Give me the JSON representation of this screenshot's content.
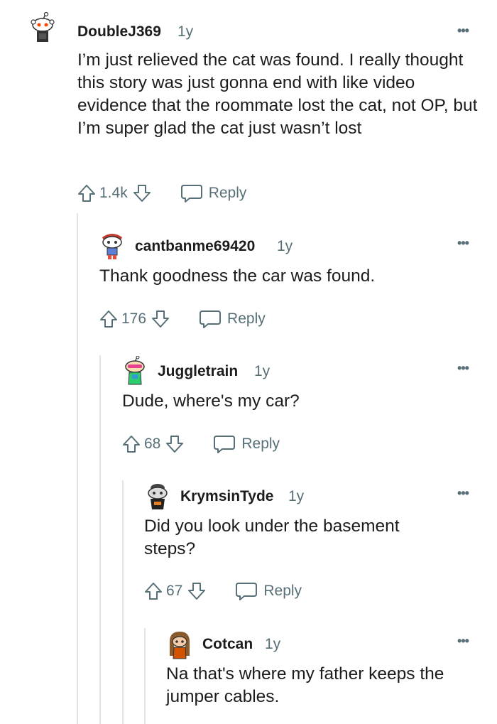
{
  "comments": [
    {
      "username": "DoubleJ369",
      "age": "1y",
      "body": "I’m just relieved the cat was found. I really thought this story was just gonna end with like video evidence that the roommate lost the cat, not OP, but I’m super glad the cat just wasn’t lost",
      "votes": "1.4k",
      "reply_label": "Reply",
      "more_label": "•••",
      "avatar": "snoo-avatar-antenna-red"
    },
    {
      "username": "cantbanme69420",
      "age": "1y",
      "body": "Thank goodness the car was found.",
      "votes": "176",
      "reply_label": "Reply",
      "more_label": "•••",
      "avatar": "snoo-avatar-red-hair"
    },
    {
      "username": "Juggletrain",
      "age": "1y",
      "body": "Dude, where's my car?",
      "votes": "68",
      "reply_label": "Reply",
      "more_label": "•••",
      "avatar": "snoo-avatar-pink-glasses"
    },
    {
      "username": "KrymsinTyde",
      "age": "1y",
      "body": "Did you look under the basement steps?",
      "votes": "67",
      "reply_label": "Reply",
      "more_label": "•••",
      "avatar": "snoo-avatar-dark-hat"
    },
    {
      "username": "Cotcan",
      "age": "1y",
      "body": "Na that's where my father keeps the jumper cables.",
      "votes": "",
      "reply_label": "",
      "more_label": "•••",
      "avatar": "snoo-avatar-brown-hair"
    }
  ],
  "colors": {
    "text": "#1c1c1c",
    "meta": "#576f76",
    "thread_line": "#e2e4e6",
    "background": "#ffffff"
  }
}
